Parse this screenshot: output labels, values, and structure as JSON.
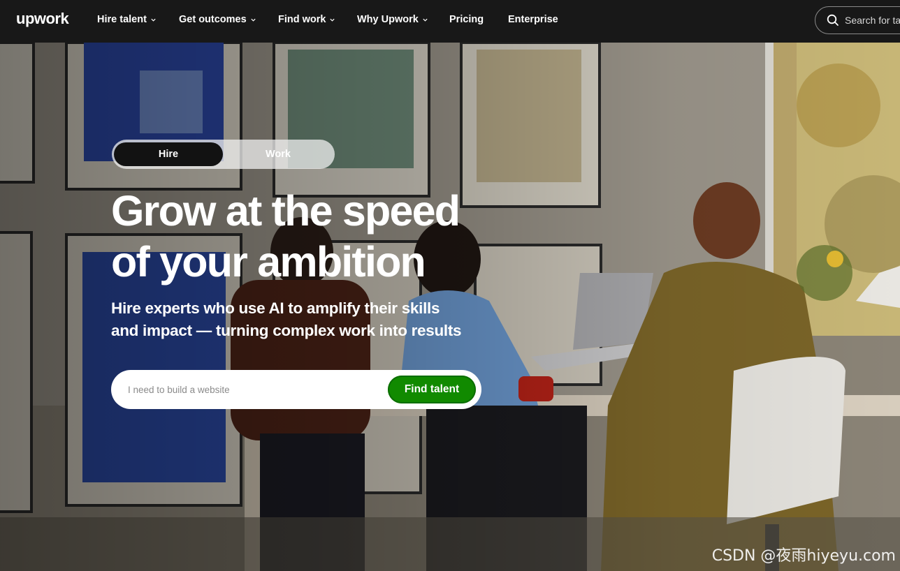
{
  "nav": {
    "logo": "upwork",
    "items": [
      {
        "label": "Hire talent",
        "dropdown": true
      },
      {
        "label": "Get outcomes",
        "dropdown": true
      },
      {
        "label": "Find work",
        "dropdown": true
      },
      {
        "label": "Why Upwork",
        "dropdown": true
      },
      {
        "label": "Pricing",
        "dropdown": false
      },
      {
        "label": "Enterprise",
        "dropdown": false
      }
    ],
    "search_placeholder": "Search for ta"
  },
  "hero": {
    "toggle": {
      "active": "Hire",
      "inactive": "Work"
    },
    "headline_line1": "Grow at the speed",
    "headline_line2": "of your ambition",
    "subhead_line1": "Hire experts who use AI to amplify their skills",
    "subhead_line2": "and impact — turning complex work into results",
    "search_placeholder": "I need to build a website",
    "search_button": "Find talent"
  },
  "colors": {
    "nav_bg": "#181818",
    "cta_green": "#118a00",
    "toggle_active": "#121212"
  },
  "watermark": "CSDN @夜雨hiyeyu.com"
}
